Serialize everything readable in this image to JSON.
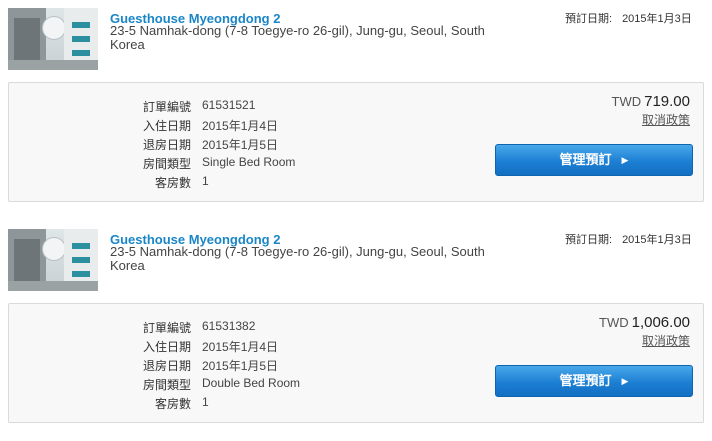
{
  "bookings": [
    {
      "hotel_name": "Guesthouse Myeongdong 2",
      "address": "23-5 Namhak-dong (7-8 Toegye-ro 26-gil), Jung-gu, Seoul, South Korea",
      "booked_date_label": "預訂日期:",
      "booked_date": "2015年1月3日",
      "fields": [
        {
          "label": "訂單編號",
          "value": "61531521"
        },
        {
          "label": "入住日期",
          "value": "2015年1月4日"
        },
        {
          "label": "退房日期",
          "value": "2015年1月5日"
        },
        {
          "label": "房間類型",
          "value": "Single Bed Room"
        },
        {
          "label": "客房數",
          "value": "1"
        }
      ],
      "currency": "TWD",
      "price": "719.00",
      "cancel_policy": "取消政策",
      "manage_label": "管理預訂",
      "manage_icon": "chevron-right-icon"
    },
    {
      "hotel_name": "Guesthouse Myeongdong 2",
      "address": "23-5 Namhak-dong (7-8 Toegye-ro 26-gil), Jung-gu, Seoul, South Korea",
      "booked_date_label": "預訂日期:",
      "booked_date": "2015年1月3日",
      "fields": [
        {
          "label": "訂單編號",
          "value": "61531382"
        },
        {
          "label": "入住日期",
          "value": "2015年1月4日"
        },
        {
          "label": "退房日期",
          "value": "2015年1月5日"
        },
        {
          "label": "房間類型",
          "value": "Double Bed Room"
        },
        {
          "label": "客房數",
          "value": "1"
        }
      ],
      "currency": "TWD",
      "price": "1,006.00",
      "cancel_policy": "取消政策",
      "manage_label": "管理預訂",
      "manage_icon": "chevron-right-icon"
    }
  ],
  "colors": {
    "hotel_link": "#1a86c8",
    "button": "#1c7fd3"
  }
}
